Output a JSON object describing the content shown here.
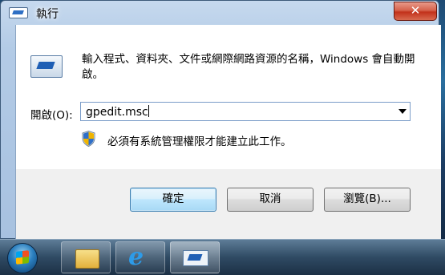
{
  "window": {
    "title": "執行",
    "close_glyph": "✕"
  },
  "dialog": {
    "description": "輸入程式、資料夾、文件或網際網路資源的名稱，Windows 會自動開啟。",
    "open_label": "開啟(O):",
    "open_value": "gpedit.msc",
    "admin_note": "必須有系統管理權限才能建立此工作。"
  },
  "buttons": {
    "ok": "確定",
    "cancel": "取消",
    "browse": "瀏覽(B)..."
  },
  "taskbar": {
    "ie_glyph": "e"
  },
  "colors": {
    "close_red": "#c2311a",
    "ok_border": "#3c7fb1",
    "frame_blue": "#b3cbe6"
  }
}
